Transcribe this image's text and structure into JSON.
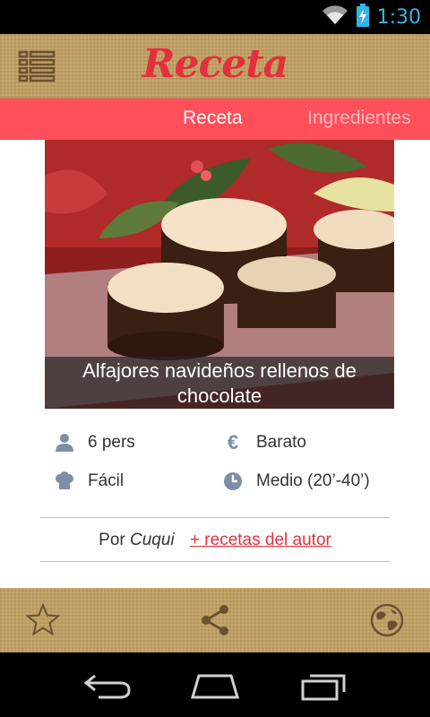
{
  "status_bar": {
    "time": "1:30"
  },
  "action_bar": {
    "title": "Receta"
  },
  "tabs": [
    {
      "label": "Receta",
      "active": true
    },
    {
      "label": "Ingredientes",
      "active": false
    }
  ],
  "recipe": {
    "title": "Alfajores navideños rellenos de chocolate",
    "info": {
      "servings": "6 pers",
      "cost": "Barato",
      "difficulty": "Fácil",
      "time": "Medio (20’-40’)"
    },
    "author_prefix": "Por",
    "author_name": "Cuqui",
    "author_link": "+ recetas del autor"
  },
  "icons": {
    "menu": "list-menu-icon",
    "servings": "person-icon",
    "cost": "euro-icon",
    "difficulty": "chef-hat-icon",
    "time": "clock-icon",
    "favorite": "star-icon",
    "share": "share-icon",
    "web": "globe-icon"
  },
  "colors": {
    "accent": "#e3313c",
    "tab_bar": "#ff4f5a",
    "bar_texture": "#c2a265",
    "info_icon": "#7d8ea8",
    "status_blue": "#33b5e5"
  }
}
